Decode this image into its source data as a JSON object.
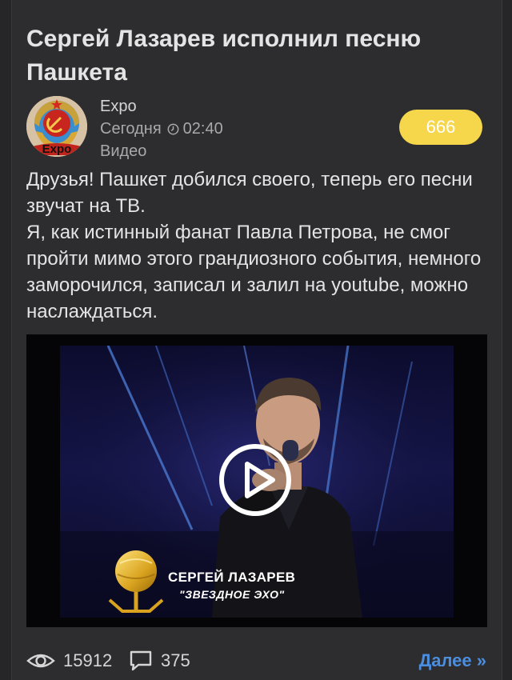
{
  "post": {
    "title": "Сергей Лазарев исполнил песню Пашкета",
    "author": "Expo",
    "avatar_text": "Expo",
    "date_label": "Сегодня",
    "time": "02:40",
    "category": "Видео",
    "rating": "666",
    "body": [
      "Друзья! Пашкет добился своего, теперь его песни звучат на ТВ.",
      "Я, как истинный фанат Павла Петрова, не смог пройти мимо этого грандиозного события, немного заморочился, записал и залил на youtube, можно наслаждаться."
    ]
  },
  "video": {
    "caption_name": "СЕРГЕЙ ЛАЗАРЕВ",
    "caption_show": "\"ЗВЕЗДНОЕ ЭХО\""
  },
  "footer": {
    "views": "15912",
    "comments": "375",
    "more_label": "Далее »"
  },
  "colors": {
    "background": "#2d2d2f",
    "rating_badge": "#f6d64a",
    "link": "#4b8ee0",
    "text": "#e4e4e4",
    "muted": "#a9a9ab"
  },
  "icons": {
    "clock": "clock-icon",
    "views": "eye-icon",
    "comments": "comment-icon",
    "play": "play-icon"
  }
}
